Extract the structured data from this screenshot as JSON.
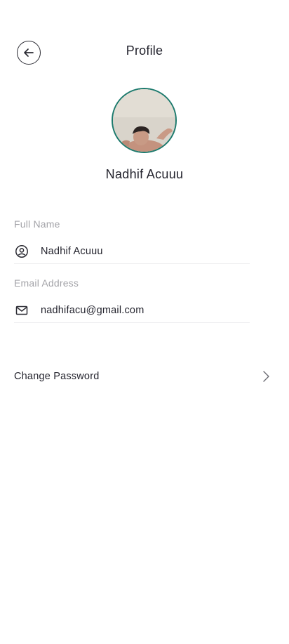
{
  "header": {
    "title": "Profile"
  },
  "profile": {
    "name": "Nadhif Acuuu"
  },
  "fields": [
    {
      "label": "Full Name",
      "value": "Nadhif Acuuu",
      "icon": "user-circle-icon"
    },
    {
      "label": "Email Address",
      "value": "nadhifacu@gmail.com",
      "icon": "mail-icon"
    }
  ],
  "actions": {
    "change_password_label": "Change Password"
  },
  "colors": {
    "avatar_ring": "#1c7a6d",
    "text": "#23232d",
    "label": "#a3a3a8",
    "divider": "#ececee"
  }
}
